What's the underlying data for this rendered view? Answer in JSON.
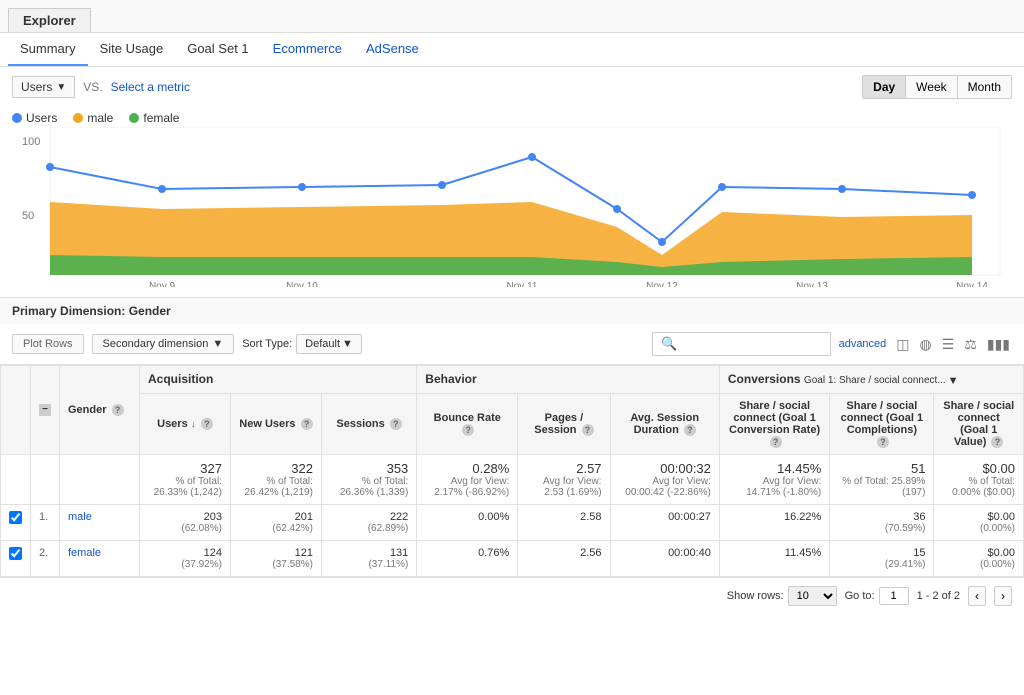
{
  "explorer_tab": "Explorer",
  "nav_tabs": [
    {
      "label": "Summary",
      "active": true
    },
    {
      "label": "Site Usage",
      "active": false
    },
    {
      "label": "Goal Set 1",
      "active": false
    },
    {
      "label": "Ecommerce",
      "active": false,
      "special": "link"
    },
    {
      "label": "AdSense",
      "active": false,
      "special": "link"
    }
  ],
  "chart": {
    "metric1": "Users",
    "vs": "VS.",
    "select_metric": "Select a metric",
    "time_buttons": [
      "Day",
      "Week",
      "Month"
    ],
    "active_time": "Day",
    "legend": [
      {
        "label": "Users",
        "color": "#4285f4"
      },
      {
        "label": "male",
        "color": "#f5a623"
      },
      {
        "label": "female",
        "color": "#4caf50"
      }
    ],
    "y_labels": [
      "100",
      "50"
    ],
    "x_labels": [
      "...",
      "Nov 9",
      "Nov 10",
      "Nov 11",
      "Nov 12",
      "Nov 13",
      "Nov 14"
    ]
  },
  "primary_dimension": "Primary Dimension:",
  "primary_dimension_value": "Gender",
  "table_controls": {
    "plot_rows": "Plot Rows",
    "secondary_dimension": "Secondary dimension",
    "sort_type_label": "Sort Type:",
    "sort_type_value": "Default",
    "advanced": "advanced"
  },
  "table": {
    "col_groups": [
      {
        "label": "Acquisition",
        "colspan": 3
      },
      {
        "label": "Behavior",
        "colspan": 3
      },
      {
        "label": "Conversions",
        "colspan": 3,
        "dropdown": "Goal 1: Share / social connect..."
      }
    ],
    "headers": [
      {
        "label": "Gender",
        "help": true
      },
      {
        "label": "Users",
        "sort": true,
        "help": true
      },
      {
        "label": "New Users",
        "help": true
      },
      {
        "label": "Sessions",
        "help": true
      },
      {
        "label": "Bounce Rate",
        "help": true
      },
      {
        "label": "Pages / Session",
        "help": true
      },
      {
        "label": "Avg. Session Duration",
        "help": true
      },
      {
        "label": "Share / social connect (Goal 1 Conversion Rate)",
        "help": true
      },
      {
        "label": "Share / social connect (Goal 1 Completions)",
        "help": true
      },
      {
        "label": "Share / social connect (Goal 1 Value)",
        "help": true
      }
    ],
    "totals": {
      "users": "327",
      "users_sub": "% of Total: 26.33% (1,242)",
      "new_users": "322",
      "new_users_sub": "% of Total: 26.42% (1,219)",
      "sessions": "353",
      "sessions_sub": "% of Total: 26.36% (1,339)",
      "bounce_rate": "0.28%",
      "bounce_rate_sub": "Avg for View: 2.17% (-86.92%)",
      "pages_session": "2.57",
      "pages_session_sub": "Avg for View: 2.53 (1.69%)",
      "avg_session": "00:00:32",
      "avg_session_sub": "Avg for View: 00:00:42 (-22.86%)",
      "conv_rate": "14.45%",
      "conv_rate_sub": "Avg for View: 14.71% (-1.80%)",
      "completions": "51",
      "completions_sub": "% of Total: 25.89% (197)",
      "goal_value": "$0.00",
      "goal_value_sub": "% of Total: 0.00% ($0.00)"
    },
    "rows": [
      {
        "num": "1.",
        "label": "male",
        "users": "203",
        "users_pct": "(62.08%)",
        "new_users": "201",
        "new_users_pct": "(62.42%)",
        "sessions": "222",
        "sessions_pct": "(62.89%)",
        "bounce_rate": "0.00%",
        "pages_session": "2.58",
        "avg_session": "00:00:27",
        "conv_rate": "16.22%",
        "completions": "36",
        "completions_pct": "(70.59%)",
        "goal_value": "$0.00",
        "goal_value_pct": "(0.00%)"
      },
      {
        "num": "2.",
        "label": "female",
        "users": "124",
        "users_pct": "(37.92%)",
        "new_users": "121",
        "new_users_pct": "(37.58%)",
        "sessions": "131",
        "sessions_pct": "(37.11%)",
        "bounce_rate": "0.76%",
        "pages_session": "2.56",
        "avg_session": "00:00:40",
        "conv_rate": "11.45%",
        "completions": "15",
        "completions_pct": "(29.41%)",
        "goal_value": "$0.00",
        "goal_value_pct": "(0.00%)"
      }
    ]
  },
  "pagination": {
    "show_rows_label": "Show rows:",
    "rows_value": "10",
    "goto_label": "Go to:",
    "goto_value": "1",
    "page_info": "1 - 2 of 2"
  }
}
